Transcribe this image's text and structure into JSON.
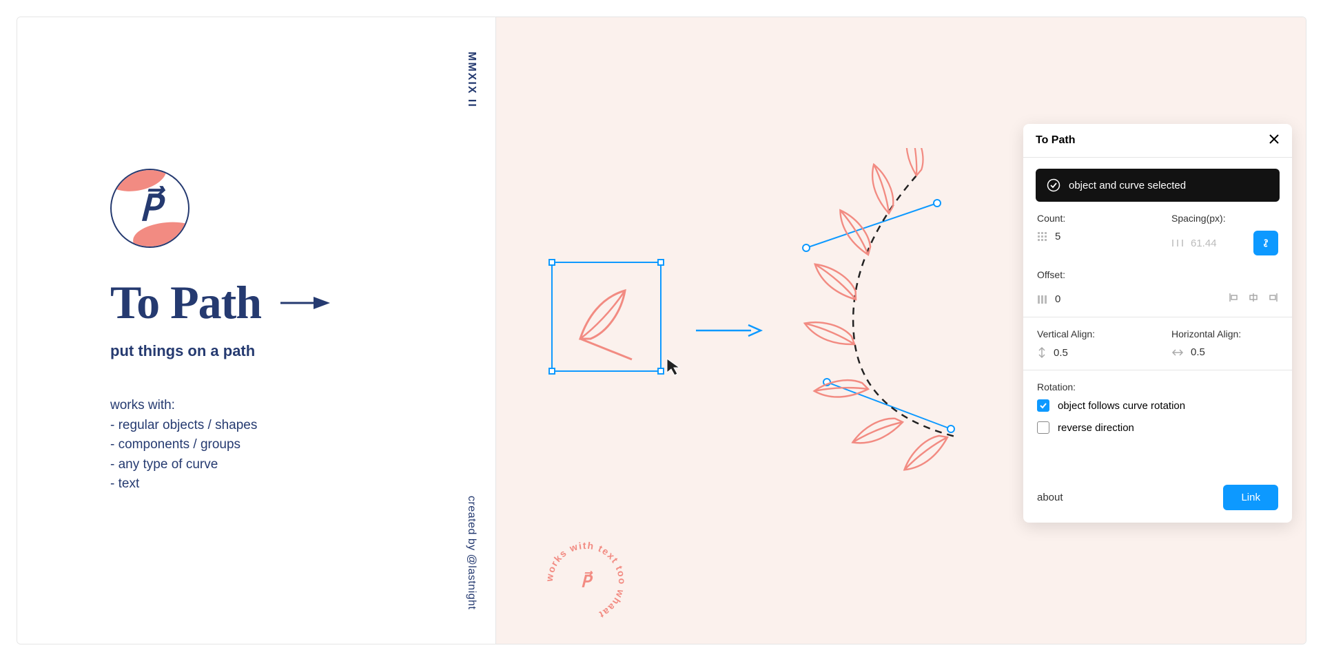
{
  "url_text": "https://www.figma.com/c/plugin/751576264585242935/To-Path",
  "doc": {
    "logo_letter": "P⃗",
    "roman": "MMXIX II",
    "title": "To Path",
    "subtitle": "put things on a path",
    "works_heading": "works with:",
    "works_items": [
      "- regular objects / shapes",
      "- components / groups",
      "- any type of curve",
      "- text"
    ],
    "credits": "created by @lastnight"
  },
  "circular_text": "works with text too whaat",
  "circular_center": "P⃗",
  "plugin": {
    "title": "To Path",
    "status": "object and curve selected",
    "count_label": "Count:",
    "count_value": "5",
    "spacing_label": "Spacing(px):",
    "spacing_value": "61.44",
    "offset_label": "Offset:",
    "offset_value": "0",
    "valign_label": "Vertical Align:",
    "valign_value": "0.5",
    "halign_label": "Horizontal Align:",
    "halign_value": "0.5",
    "rotation_label": "Rotation:",
    "opt_follow": "object follows curve rotation",
    "opt_follow_checked": true,
    "opt_reverse": "reverse direction",
    "opt_reverse_checked": false,
    "about": "about",
    "link_btn": "Link"
  },
  "colors": {
    "navy": "#253a70",
    "coral": "#f28b82",
    "blue": "#0d99ff",
    "peach_bg": "#fbf1ed"
  }
}
